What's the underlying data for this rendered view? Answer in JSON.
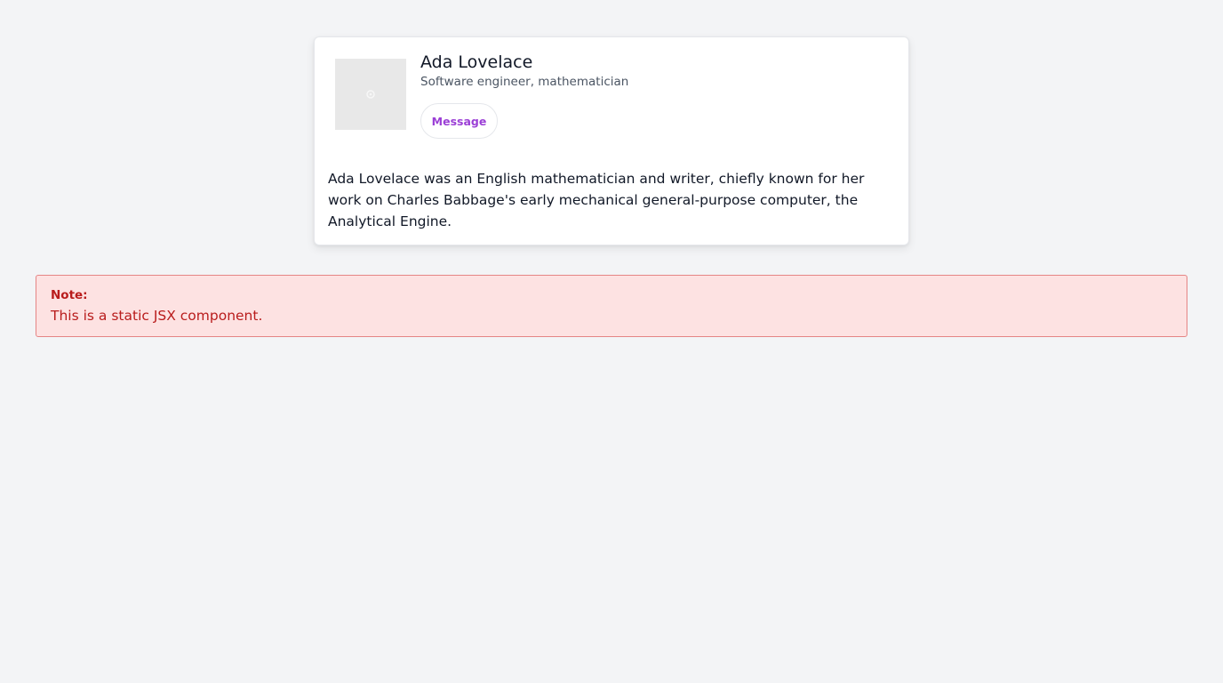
{
  "profile": {
    "name": "Ada Lovelace",
    "subtitle": "Software engineer, mathematician",
    "avatar_icon": "image-placeholder-icon",
    "message_label": "Message",
    "bio": "Ada Lovelace was an English mathematician and writer, chiefly known for her work on Charles Babbage's early mechanical general-purpose computer, the Analytical Engine."
  },
  "note": {
    "title": "Note:",
    "text": "This is a static JSX component."
  },
  "colors": {
    "background": "#f3f4f6",
    "accent": "#9b3fd6",
    "note_bg": "#fde2e2",
    "note_border": "#e58585",
    "note_text": "#b91c1c"
  }
}
